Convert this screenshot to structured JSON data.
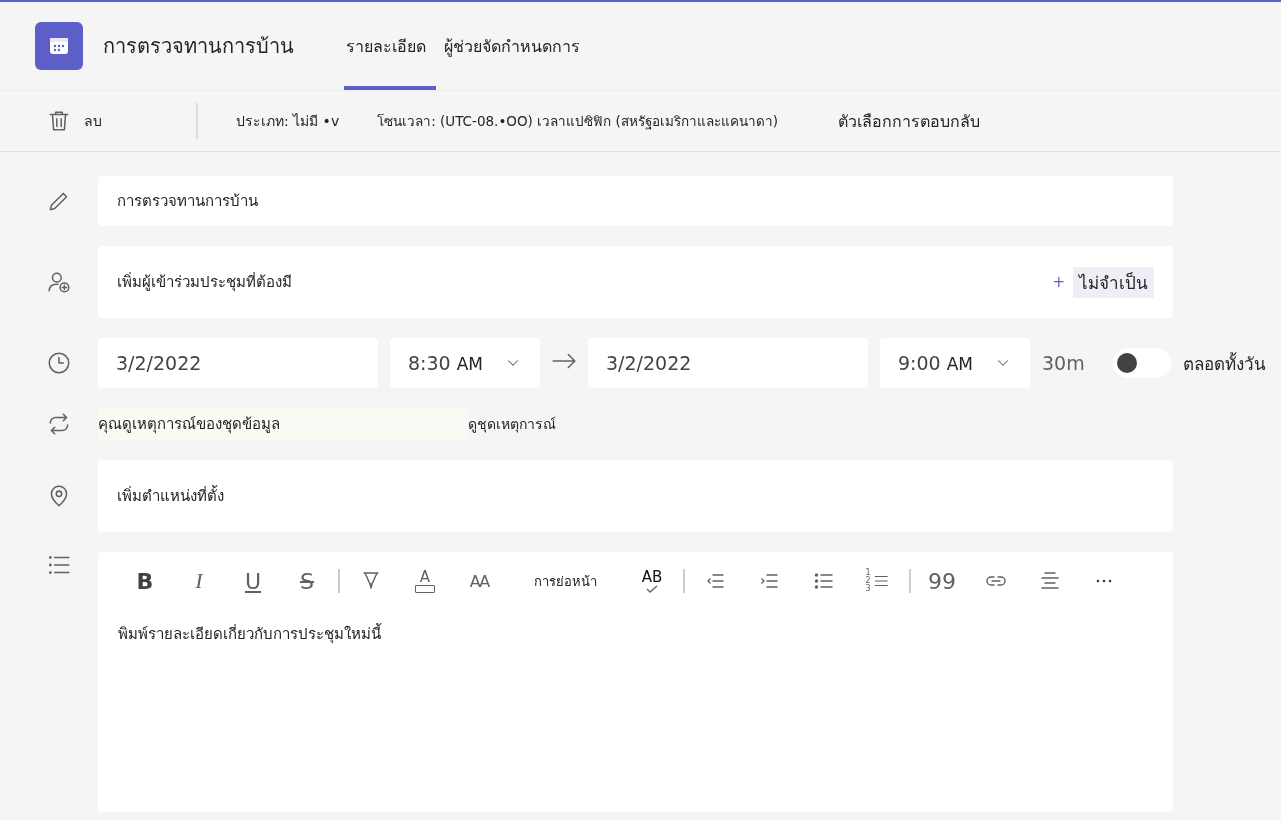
{
  "header": {
    "title": "การตรวจทานการบ้าน",
    "tabs": [
      {
        "label": "รายละเอียด",
        "selected": true
      },
      {
        "label": "ผู้ช่วยจัดกำหนดการ",
        "selected": false
      }
    ]
  },
  "commands": {
    "delete": "ลบ",
    "category": "ประเภท: ไม่มี •v",
    "timezone": "โซนเวลา: (UTC-08.•OO) เวลาแปซิฟิก (สหรัฐอเมริกาและแคนาดา)",
    "response": "ตัวเลือกการตอบกลับ"
  },
  "title_field": {
    "value": "การตรวจทานการบ้าน"
  },
  "attendees": {
    "placeholder": "เพิ่มผู้เข้าร่วมประชุมที่ต้องมี",
    "optional_plus": "+",
    "optional": "ไม่จำเป็น"
  },
  "time": {
    "start_date": "3/2/2022",
    "start_time": "8:30",
    "start_ampm": "AM",
    "end_date": "3/2/2022",
    "end_time": "9:00",
    "end_ampm": "AM",
    "duration": "30m",
    "all_day": {
      "label": "ตลอดทั้งวัน",
      "on": false
    }
  },
  "recurrence": {
    "text": "คุณดูเหตุการณ์ของชุดข้อมูล",
    "link": "ดูชุดเหตุการณ์"
  },
  "location": {
    "placeholder": "เพิ่มตำแหน่งที่ตั้ง"
  },
  "editor": {
    "toolbar": [
      {
        "kind": "bold",
        "text": "B"
      },
      {
        "kind": "italic",
        "text": "I"
      },
      {
        "kind": "underline",
        "text": "U"
      },
      {
        "kind": "strike",
        "text": "S"
      },
      {
        "kind": "separator"
      },
      {
        "kind": "highlight"
      },
      {
        "kind": "font-color",
        "text": "A"
      },
      {
        "kind": "font-size",
        "text": "AA"
      },
      {
        "kind": "label",
        "text": "การย่อหน้า"
      },
      {
        "kind": "spell",
        "text": "AB"
      },
      {
        "kind": "separator"
      },
      {
        "kind": "outdent"
      },
      {
        "kind": "indent"
      },
      {
        "kind": "bullets"
      },
      {
        "kind": "numbered",
        "text": "123"
      },
      {
        "kind": "separator"
      },
      {
        "kind": "quote",
        "text": "99"
      },
      {
        "kind": "link"
      },
      {
        "kind": "align"
      },
      {
        "kind": "more"
      }
    ],
    "placeholder": "พิมพ์รายละเอียดเกี่ยวกับการประชุมใหม่นี้"
  }
}
